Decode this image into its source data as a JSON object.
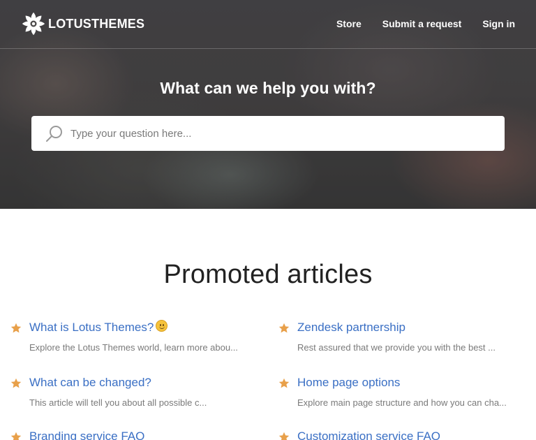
{
  "header": {
    "logo_text": "LOTUSTHEMES",
    "nav": [
      {
        "label": "Store"
      },
      {
        "label": "Submit a request"
      },
      {
        "label": "Sign in"
      }
    ]
  },
  "hero": {
    "title": "What can we help you with?",
    "search": {
      "placeholder": "Type your question here...",
      "value": "",
      "icon": "search-icon"
    }
  },
  "promoted": {
    "title": "Promoted articles",
    "star_color": "#e8a04a",
    "link_color": "#3a6fc4",
    "articles": [
      {
        "title": "What is Lotus Themes?",
        "emoji": "smiling-face",
        "desc": "Explore the Lotus Themes world, learn more abou..."
      },
      {
        "title": "Zendesk partnership",
        "desc": "Rest assured that we provide you with the best ..."
      },
      {
        "title": "What can be changed?",
        "desc": "This article will tell you about all possible c..."
      },
      {
        "title": "Home page options",
        "desc": "Explore main page structure and how you can cha..."
      },
      {
        "title": "Branding service FAQ",
        "desc": ""
      },
      {
        "title": "Customization service FAQ",
        "desc": ""
      }
    ]
  }
}
